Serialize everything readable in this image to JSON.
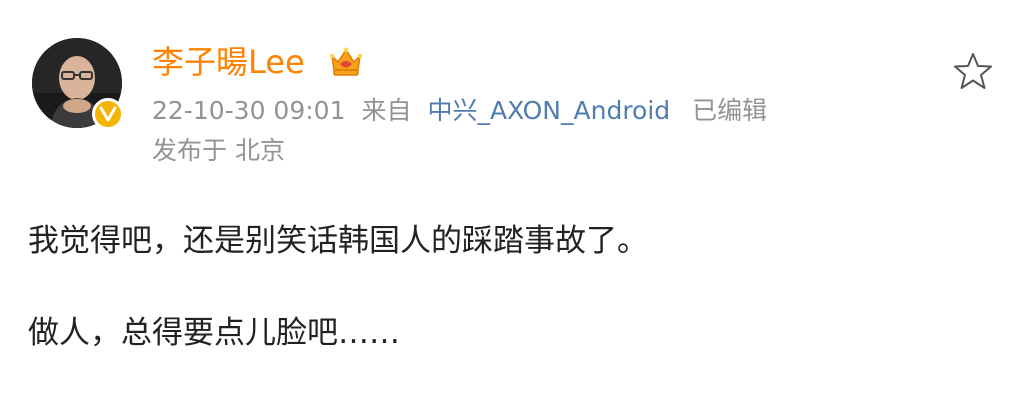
{
  "post": {
    "author": {
      "name": "李子暘Lee",
      "avatar_icon": "user-avatar-photo",
      "badge_icon": "verified-v-icon",
      "vip_icon": "crown-icon"
    },
    "meta": {
      "timestamp": "22-10-30 09:01",
      "from_label": "来自",
      "source": "中兴_AXON_Android",
      "edited_label": "已编辑"
    },
    "location": "发布于 北京",
    "content": [
      "我觉得吧，还是别笑话韩国人的踩踏事故了。",
      "做人，总得要点儿脸吧……"
    ],
    "actions": {
      "favorite_icon": "star-icon"
    }
  },
  "colors": {
    "username": "#ff8200",
    "meta": "#939393",
    "link": "#507daf",
    "text": "#222222",
    "badge": "#f4b400"
  }
}
